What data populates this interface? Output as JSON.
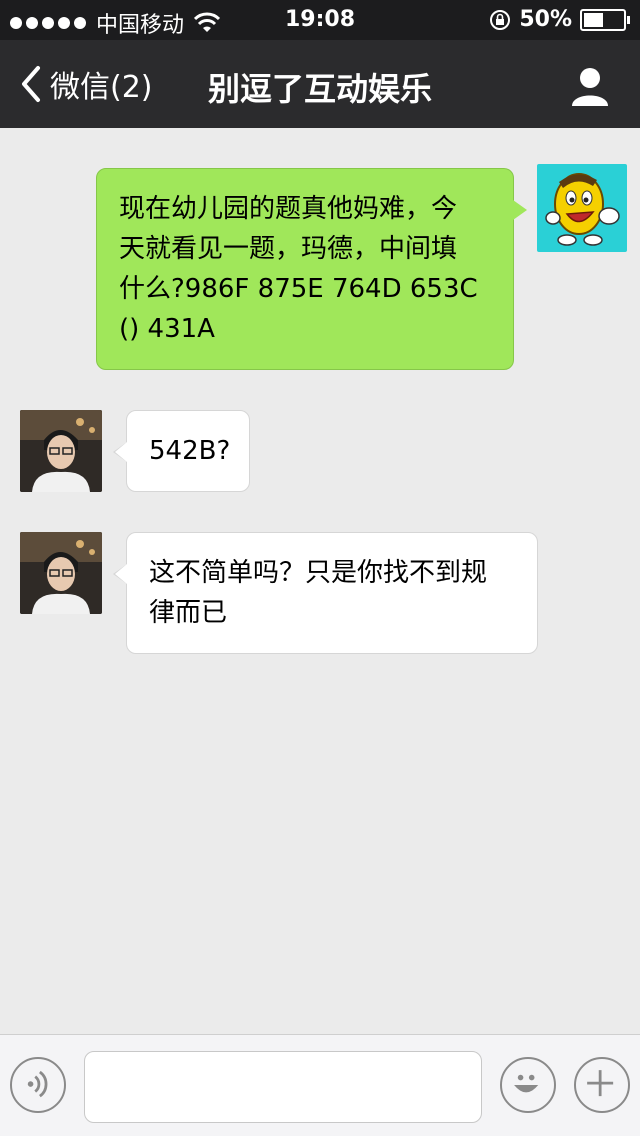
{
  "status_bar": {
    "carrier": "中国移动",
    "time": "19:08",
    "battery_percent": "50%",
    "battery_level": 0.5,
    "icons": [
      "signal-dots-icon",
      "wifi-icon",
      "rotation-lock-icon",
      "battery-icon"
    ]
  },
  "nav": {
    "back_label": "微信(2)",
    "title": "别逗了互动娱乐",
    "icons": [
      "back-chevron-icon",
      "profile-icon"
    ]
  },
  "messages": [
    {
      "direction": "outgoing",
      "lines": [
        "现在幼儿园的题真他妈难，今",
        "天就看见一题，玛德，中间填",
        "什么?986F 875E 764D 653C",
        "() 431A"
      ]
    },
    {
      "direction": "incoming",
      "lines": [
        "542B?"
      ]
    },
    {
      "direction": "incoming",
      "lines": [
        "这不简单吗？只是你找不到规",
        "律而已"
      ]
    }
  ],
  "input_bar": {
    "value": "",
    "icons": [
      "voice-icon",
      "emoji-icon",
      "plus-icon"
    ]
  },
  "colors": {
    "outgoing_bubble": "#a0e75a",
    "incoming_bubble": "#ffffff",
    "nav_background": "#2b2b2d",
    "chat_background": "#ebebeb"
  }
}
